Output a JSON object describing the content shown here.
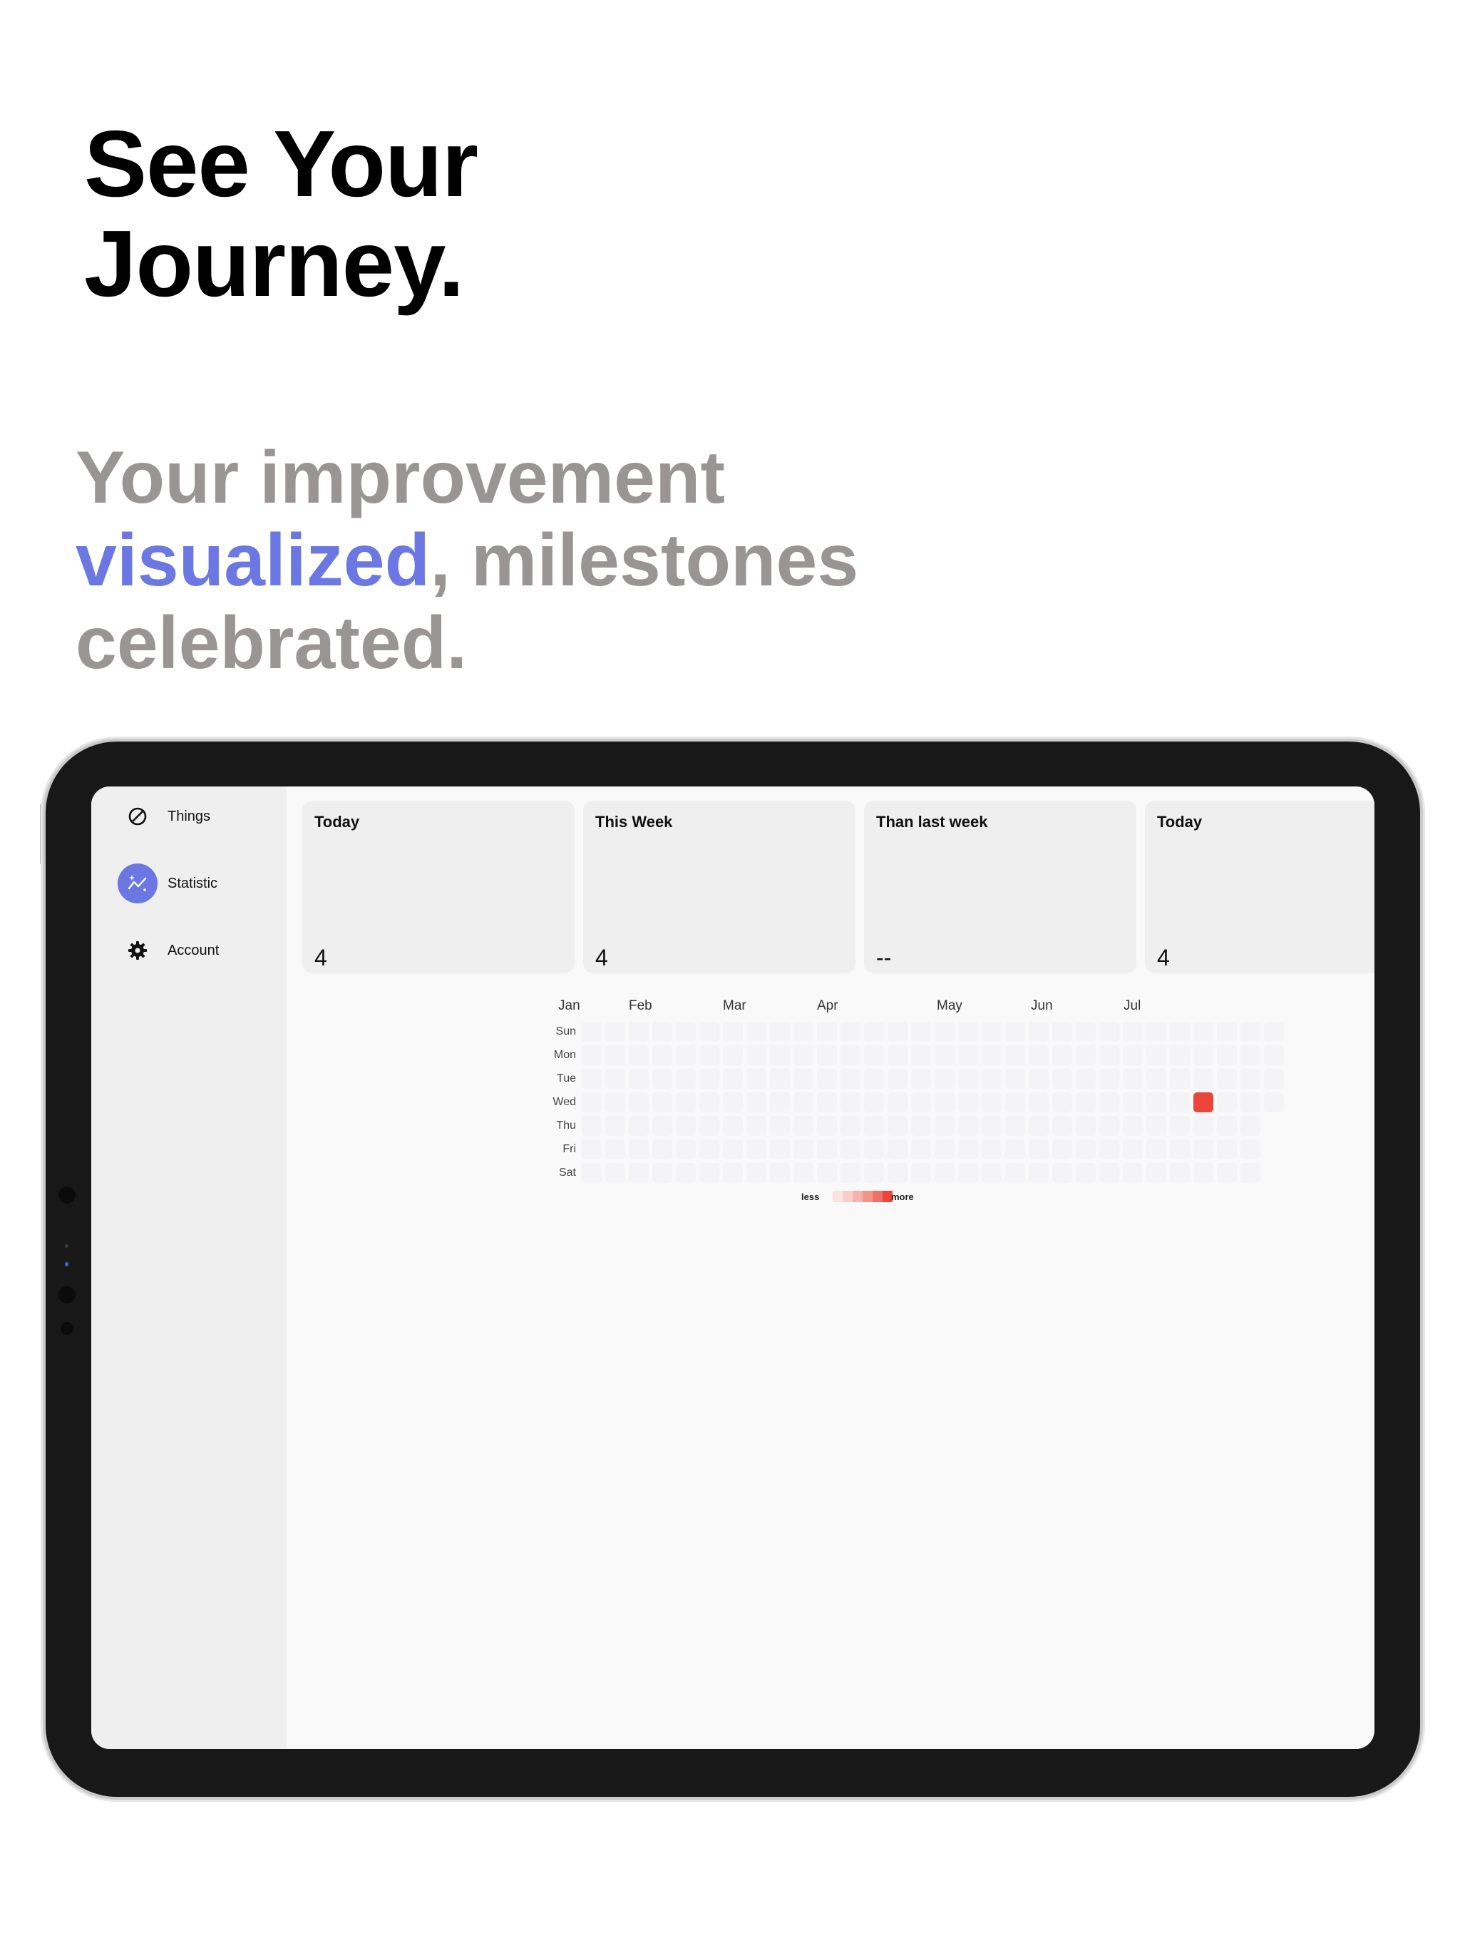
{
  "hero": {
    "title_line1": "See Your",
    "title_line2": "Journey.",
    "sub_line1": "Your improvement",
    "sub_accent": "visualized",
    "sub_line2_rest": ", milestones",
    "sub_line3": "celebrated."
  },
  "sidebar": {
    "items": [
      {
        "label": "Things",
        "icon": "prohibited-circle-icon"
      },
      {
        "label": "Statistic",
        "icon": "sparkle-chart-icon"
      },
      {
        "label": "Account",
        "icon": "gear-icon"
      }
    ]
  },
  "cards": [
    {
      "title": "Today",
      "value": "4"
    },
    {
      "title": "This Week",
      "value": "4"
    },
    {
      "title": "Than last week",
      "value": "--"
    },
    {
      "title": "Today",
      "value": "4"
    }
  ],
  "heatmap": {
    "months": [
      "Jan",
      "Feb",
      "Mar",
      "Apr",
      "May",
      "Jun",
      "Jul"
    ],
    "days": [
      "Sun",
      "Mon",
      "Tue",
      "Wed",
      "Thu",
      "Fri",
      "Sat"
    ],
    "active": {
      "day": "Wed",
      "week_index": 26,
      "level": "max"
    },
    "legend_less": "less",
    "legend_more": "more"
  },
  "colors": {
    "accent": "#6b78e3",
    "heat_high": "#ec4438",
    "empty_cell": "#f4f4f6"
  }
}
